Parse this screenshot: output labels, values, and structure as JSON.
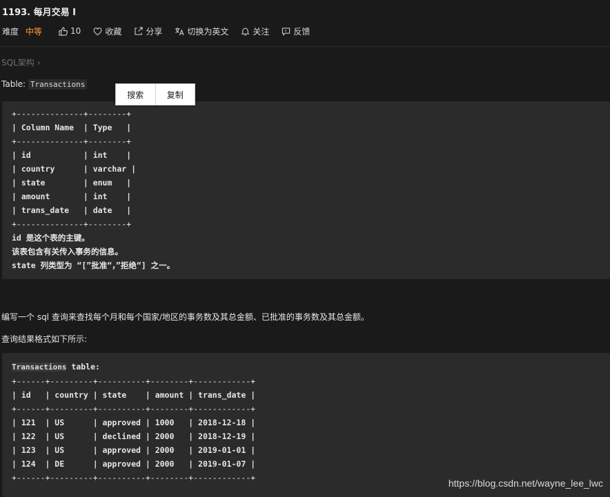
{
  "problem": {
    "title": "1193. 每月交易 I"
  },
  "meta": {
    "difficulty_label": "难度",
    "difficulty_value": "中等",
    "likes": "10",
    "favorite": "收藏",
    "share": "分享",
    "switch_lang": "切换为英文",
    "follow": "关注",
    "feedback": "反馈",
    "difficulty_color": "#ff9b3d"
  },
  "breadcrumb": "SQL架构 ›",
  "table_label": {
    "prefix": "Table: ",
    "name": "Transactions"
  },
  "context_menu": {
    "search": "搜索",
    "copy": "复制"
  },
  "schema_block": [
    "+--------------+--------+",
    "| Column Name  | Type   |",
    "+--------------+--------+",
    "| id           | int    |",
    "| country      | varchar |",
    "| state        | enum   |",
    "| amount       | int    |",
    "| trans_date   | date   |",
    "+--------------+--------+",
    "id 是这个表的主键。",
    "该表包含有关传入事务的信息。",
    "state 列类型为 “[”批准“，”拒绝“] 之一。"
  ],
  "description": "编写一个 sql 查询来查找每个月和每个国家/地区的事务数及其总金额、已批准的事务数及其总金额。",
  "format_note": "查询结果格式如下所示:",
  "example_block": {
    "heading_name": "Transactions",
    "heading_suffix": " table:",
    "lines": [
      "+------+---------+----------+--------+------------+",
      "| id   | country | state    | amount | trans_date |",
      "+------+---------+----------+--------+------------+",
      "| 121  | US      | approved | 1000   | 2018-12-18 |",
      "| 122  | US      | declined | 2000   | 2018-12-19 |",
      "| 123  | US      | approved | 2000   | 2019-01-01 |",
      "| 124  | DE      | approved | 2000   | 2019-01-07 |",
      "+------+---------+----------+--------+------------+"
    ]
  },
  "watermark": "https://blog.csdn.net/wayne_lee_lwc"
}
